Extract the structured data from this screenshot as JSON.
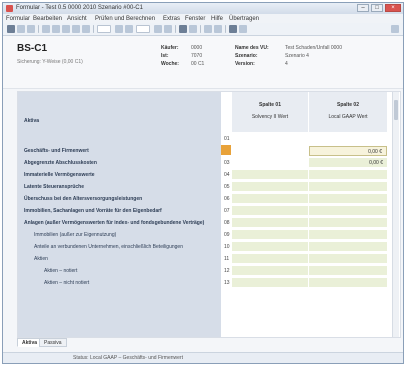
{
  "window": {
    "title": "Formular - Test 0.5 0000 2010 Szenario #00-C1",
    "controls": [
      "–",
      "□",
      "×"
    ]
  },
  "menu": [
    "Formular",
    "Bearbeiten",
    "Ansicht",
    "Prüfen und Berechnen",
    "Extras",
    "Fenster",
    "Hilfe",
    "Übertragen"
  ],
  "form": {
    "title": "BS-C1",
    "subtitle": "Sicherung: Y-Weise (0,00 C1)",
    "meta": [
      {
        "label": "Käufer:",
        "value": "0000"
      },
      {
        "label": "Ist:",
        "value": "7070"
      },
      {
        "label": "Woche:",
        "value": "00 C1"
      },
      {
        "label": "Name des VU:",
        "value": "Test Schaden/Unfall 0000"
      },
      {
        "label": "Szenario:",
        "value": "Szenario 4"
      },
      {
        "label": "Version:",
        "value": "4"
      }
    ]
  },
  "table": {
    "header_label": "Aktiva",
    "col1": {
      "title": "Spalte 01",
      "sub": "Solvency II Wert"
    },
    "col2": {
      "title": "Spalte 02",
      "sub": "Local GAAP Wert"
    },
    "rows": [
      {
        "num": "01",
        "label": "",
        "v1": "",
        "v2": ""
      },
      {
        "num": "02",
        "label": "Geschäfts- und Firmenwert",
        "v1": "",
        "v2": "0,00 €"
      },
      {
        "num": "03",
        "label": "Abgegrenzte Abschlusskosten",
        "v1": "",
        "v2": "0,00 €"
      },
      {
        "num": "04",
        "label": "Immaterielle Vermögenswerte",
        "v1": "",
        "v2": ""
      },
      {
        "num": "05",
        "label": "Latente Steueransprüche",
        "v1": "",
        "v2": ""
      },
      {
        "num": "06",
        "label": "Überschuss bei den Altersversorgungsleistungen",
        "v1": "",
        "v2": ""
      },
      {
        "num": "07",
        "label": "Immobilien, Sachanlagen und Vorräte für den Eigenbedarf",
        "v1": "",
        "v2": ""
      },
      {
        "num": "08",
        "label": "Anlagen (außer Vermögenswerten für index- und fondsgebundene Verträge)",
        "v1": "",
        "v2": ""
      },
      {
        "num": "09",
        "label": "Immobilien (außer zur Eigennutzung)",
        "v1": "",
        "v2": ""
      },
      {
        "num": "10",
        "label": "Anteile an verbundenen Unternehmen, einschließlich Beteiligungen",
        "v1": "",
        "v2": ""
      },
      {
        "num": "11",
        "label": "Aktien",
        "v1": "",
        "v2": ""
      },
      {
        "num": "12",
        "label": "Aktien – notiert",
        "v1": "",
        "v2": ""
      },
      {
        "num": "13",
        "label": "Aktien – nicht notiert",
        "v1": "",
        "v2": ""
      }
    ]
  },
  "tabs": [
    "Aktiva",
    "Passiva"
  ],
  "status": {
    "text": "Status: Local GAAP – Geschäfts- und Firmenwert"
  }
}
